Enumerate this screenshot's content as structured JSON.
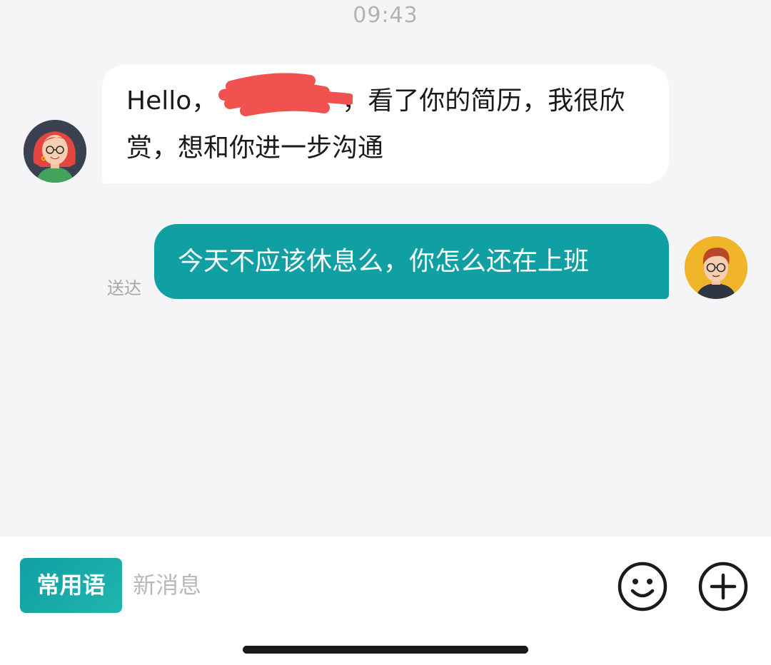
{
  "chat": {
    "timestamp": "09:43",
    "messages": [
      {
        "direction": "incoming",
        "text_start": "Hello，",
        "text_end": "，看了你的简历，我很欣赏，想和你进一步沟通"
      },
      {
        "direction": "outgoing",
        "text": "今天不应该休息么，你怎么还在上班",
        "status": "送达"
      }
    ]
  },
  "input_bar": {
    "phrases_label": "常用语",
    "placeholder": "新消息",
    "emoji_icon": "smiley-face-icon",
    "plus_icon": "plus-circle-icon"
  },
  "colors": {
    "accent": "#109fa3",
    "background": "#f5f5f7",
    "redaction": "#f0524f"
  }
}
